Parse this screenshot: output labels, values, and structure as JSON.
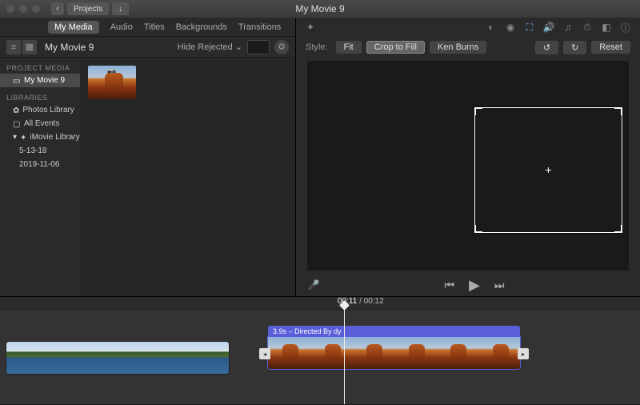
{
  "window": {
    "title": "My Movie 9"
  },
  "titlebar_buttons": {
    "back_label": "Projects"
  },
  "tabs": {
    "items": [
      "My Media",
      "Audio",
      "Titles",
      "Backgrounds",
      "Transitions"
    ],
    "active_index": 0
  },
  "browser_bar": {
    "title": "My Movie 9",
    "filter_label": "Hide Rejected",
    "search_placeholder": ""
  },
  "sidebar": {
    "sections": [
      {
        "header": "PROJECT MEDIA",
        "items": [
          {
            "label": "My Movie 9",
            "selected": true,
            "icon": "film-icon"
          }
        ]
      },
      {
        "header": "LIBRARIES",
        "items": [
          {
            "label": "Photos Library",
            "icon": "photos-icon"
          },
          {
            "label": "All Events",
            "icon": "square-icon"
          },
          {
            "label": "iMovie Library",
            "icon": "star-icon",
            "expanded": true,
            "children": [
              {
                "label": "5-13-18"
              },
              {
                "label": "2019-11-06"
              }
            ]
          }
        ]
      }
    ]
  },
  "crop_toolbar": {
    "style_label": "Style:",
    "options": [
      "Fit",
      "Crop to Fill",
      "Ken Burns"
    ],
    "active_index": 1,
    "rotate_left": "↺",
    "rotate_right": "↻",
    "reset_label": "Reset"
  },
  "viewer_toolbar_icons": [
    "wand-icon",
    "balance-icon",
    "color-icon",
    "crop-icon",
    "volume-icon",
    "noise-icon",
    "speed-icon",
    "clip-icon",
    "info-icon"
  ],
  "transport": {
    "mic": "mic-icon",
    "prev": "prev-icon",
    "play": "play-icon",
    "next": "next-icon"
  },
  "timeline": {
    "current_time": "00:11",
    "total_time": "00:12",
    "clip2_label": "3.9s – Directed By dy"
  }
}
